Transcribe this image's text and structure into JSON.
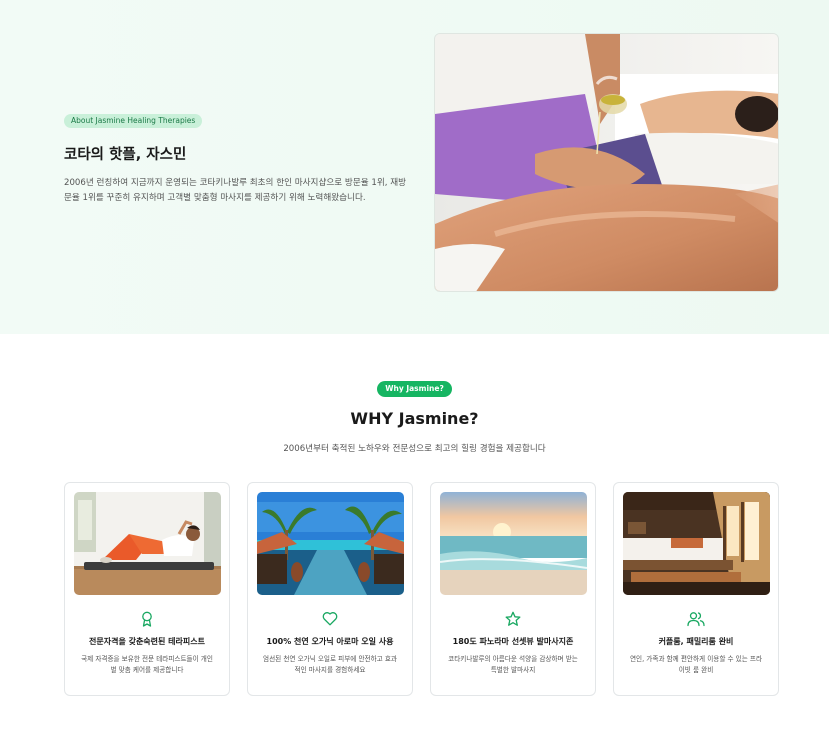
{
  "about": {
    "badge": "About Jasmine Healing Therapies",
    "title": "코타의 핫플, 자스민",
    "description": "2006년 런칭하여 지금까지 운영되는 코타키나발루 최초의 한인 마사지샵으로 방문율 1위, 재방문율 1위를 꾸준히 유지하며 고객별 맞춤형 마사지를 제공하기 위해 노력해왔습니다."
  },
  "why": {
    "badge": "Why Jasmine?",
    "title": "WHY Jasmine?",
    "subtitle": "2006년부터 축적된 노하우와 전문성으로 최고의 힐링 경험을 제공합니다",
    "cards": [
      {
        "icon": "award-icon",
        "title": "전문자격을 갖춘숙련된 테라피스트",
        "desc": "국제 자격증을 보유한 전문 테라피스트들이 개인별 맞춤 케어를 제공합니다"
      },
      {
        "icon": "heart-icon",
        "title": "100% 천연 오가닉 아로마 오일 사용",
        "desc": "엄선된 천연 오가닉 오일로 피부에 안전하고 효과적인 마사지를 경험하세요"
      },
      {
        "icon": "star-icon",
        "title": "180도 파노라마 선셋뷰 발마사지존",
        "desc": "코타키나발루의 아름다운 석양을 감상하며 받는 특별한 발마사지"
      },
      {
        "icon": "users-icon",
        "title": "커플룸, 패밀리룸 완비",
        "desc": "연인, 가족과 함께 편안하게 이용할 수 있는 프라이빗 룸 완비"
      }
    ]
  },
  "colors": {
    "accent": "#16b562",
    "icon": "#1aa862",
    "badge_bg": "#c9f0d9"
  }
}
